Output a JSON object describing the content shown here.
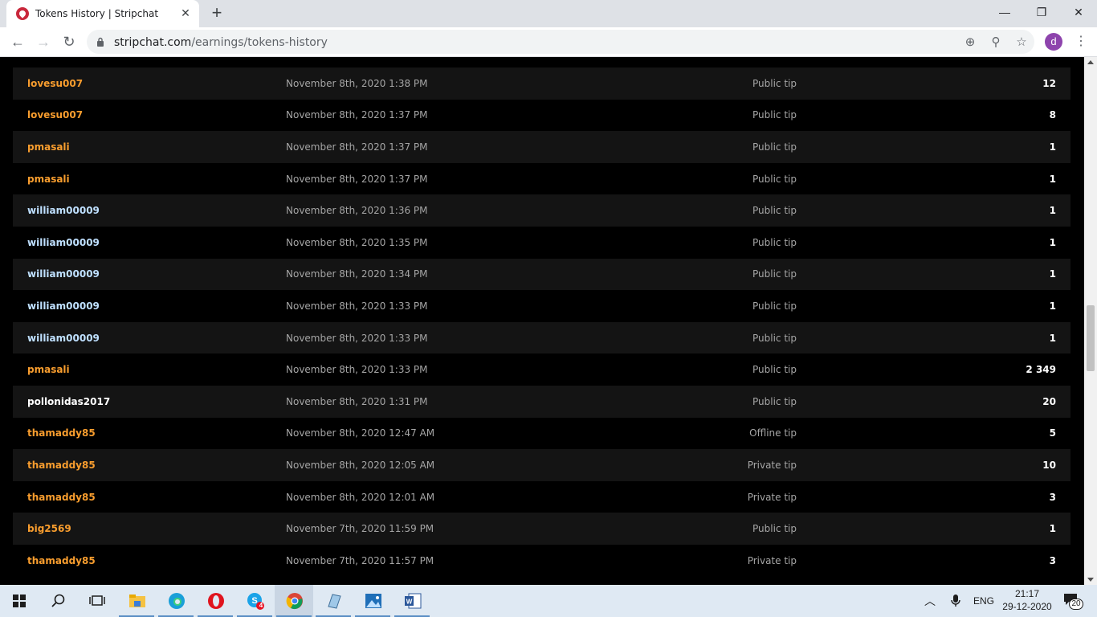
{
  "browser": {
    "tab_title": "Tokens History | Stripchat",
    "tab_close": "✕",
    "new_tab": "+",
    "url_host": "stripchat.com",
    "url_path": "/earnings/tokens-history",
    "avatar_letter": "d",
    "window_controls": {
      "minimize": "—",
      "restore": "❐",
      "close": "✕"
    }
  },
  "rows": [
    {
      "user": "lovesu007",
      "user_color": "orange",
      "date": "November 8th, 2020 1:38 PM",
      "type": "Public tip",
      "amount": "12"
    },
    {
      "user": "lovesu007",
      "user_color": "orange",
      "date": "November 8th, 2020 1:37 PM",
      "type": "Public tip",
      "amount": "8"
    },
    {
      "user": "pmasali",
      "user_color": "orange",
      "date": "November 8th, 2020 1:37 PM",
      "type": "Public tip",
      "amount": "1"
    },
    {
      "user": "pmasali",
      "user_color": "orange",
      "date": "November 8th, 2020 1:37 PM",
      "type": "Public tip",
      "amount": "1"
    },
    {
      "user": "william00009",
      "user_color": "blue",
      "date": "November 8th, 2020 1:36 PM",
      "type": "Public tip",
      "amount": "1"
    },
    {
      "user": "william00009",
      "user_color": "blue",
      "date": "November 8th, 2020 1:35 PM",
      "type": "Public tip",
      "amount": "1"
    },
    {
      "user": "william00009",
      "user_color": "blue",
      "date": "November 8th, 2020 1:34 PM",
      "type": "Public tip",
      "amount": "1"
    },
    {
      "user": "william00009",
      "user_color": "blue",
      "date": "November 8th, 2020 1:33 PM",
      "type": "Public tip",
      "amount": "1"
    },
    {
      "user": "william00009",
      "user_color": "blue",
      "date": "November 8th, 2020 1:33 PM",
      "type": "Public tip",
      "amount": "1"
    },
    {
      "user": "pmasali",
      "user_color": "orange",
      "date": "November 8th, 2020 1:33 PM",
      "type": "Public tip",
      "amount": "2 349"
    },
    {
      "user": "pollonidas2017",
      "user_color": "white",
      "date": "November 8th, 2020 1:31 PM",
      "type": "Public tip",
      "amount": "20"
    },
    {
      "user": "thamaddy85",
      "user_color": "orange",
      "date": "November 8th, 2020 12:47 AM",
      "type": "Offline tip",
      "amount": "5"
    },
    {
      "user": "thamaddy85",
      "user_color": "orange",
      "date": "November 8th, 2020 12:05 AM",
      "type": "Private tip",
      "amount": "10"
    },
    {
      "user": "thamaddy85",
      "user_color": "orange",
      "date": "November 8th, 2020 12:01 AM",
      "type": "Private tip",
      "amount": "3"
    },
    {
      "user": "big2569",
      "user_color": "orange",
      "date": "November 7th, 2020 11:59 PM",
      "type": "Public tip",
      "amount": "1"
    },
    {
      "user": "thamaddy85",
      "user_color": "orange",
      "date": "November 7th, 2020 11:57 PM",
      "type": "Private tip",
      "amount": "3"
    }
  ],
  "colors": {
    "orange": "#f89d2e",
    "blue": "#bfe0ff",
    "white": "#ffffff"
  },
  "taskbar": {
    "apps": [
      "windows-start-icon",
      "search-icon",
      "task-view-icon",
      "file-explorer-icon",
      "edge-icon",
      "opera-icon",
      "skype-icon",
      "chrome-icon",
      "notepad-icon",
      "photos-icon",
      "word-icon"
    ],
    "skype_badge": "4",
    "language": "ENG",
    "time": "21:17",
    "date": "29-12-2020",
    "notification_count": "20"
  }
}
